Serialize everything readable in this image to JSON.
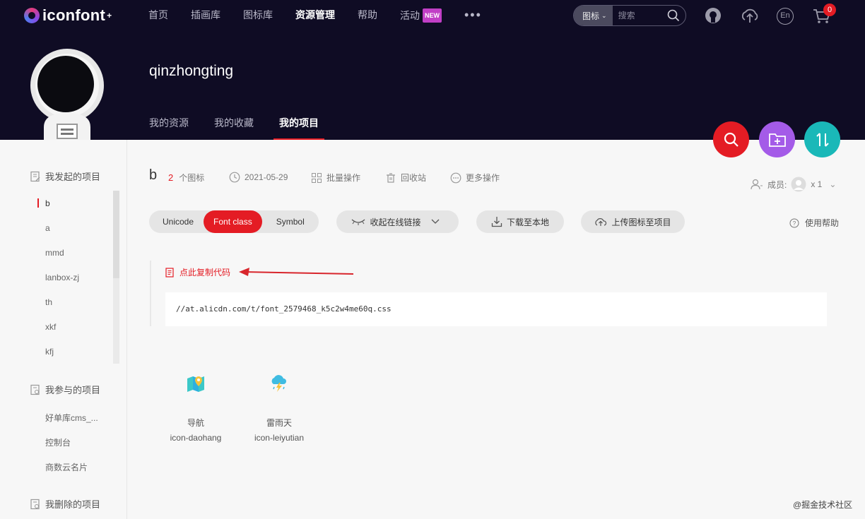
{
  "header": {
    "logo_text": "iconfont",
    "logo_sup": "+",
    "nav": [
      {
        "label": "首页",
        "active": false
      },
      {
        "label": "插画库",
        "active": false
      },
      {
        "label": "图标库",
        "active": false
      },
      {
        "label": "资源管理",
        "active": true
      },
      {
        "label": "帮助",
        "active": false
      },
      {
        "label": "活动",
        "active": false,
        "badge": "NEW"
      }
    ],
    "more": "•••",
    "search": {
      "type": "图标",
      "placeholder": "搜索"
    },
    "cart_count": "0",
    "lang": "En"
  },
  "profile": {
    "username": "qinzhongting",
    "tabs": [
      {
        "label": "我的资源",
        "active": false
      },
      {
        "label": "我的收藏",
        "active": false
      },
      {
        "label": "我的项目",
        "active": true
      }
    ]
  },
  "sidebar": {
    "initiated_title": "我发起的项目",
    "initiated": [
      "b",
      "a",
      "mmd",
      "lanbox-zj",
      "th",
      "xkf",
      "kfj"
    ],
    "joined_title": "我参与的项目",
    "joined": [
      "好单库cms_...",
      "控制台",
      "商数云名片"
    ],
    "deleted_title": "我删除的项目"
  },
  "project": {
    "name": "b",
    "icon_count": "2",
    "icon_count_unit": "个图标",
    "date": "2021-05-29",
    "batch": "批量操作",
    "recycle": "回收站",
    "more_ops": "更多操作",
    "members_label": "成员:",
    "members_count": "x 1"
  },
  "toolbar": {
    "segments": [
      {
        "label": "Unicode",
        "active": false
      },
      {
        "label": "Font class",
        "active": true
      },
      {
        "label": "Symbol",
        "active": false
      }
    ],
    "collapse_link": "收起在线链接",
    "download": "下载至本地",
    "upload": "上传图标至项目",
    "help": "使用帮助"
  },
  "code": {
    "copy_label": "点此复制代码",
    "url": "//at.alicdn.com/t/font_2579468_k5c2w4me60q.css"
  },
  "icons": [
    {
      "name": "导航",
      "class": "icon-daohang",
      "glyph": "map-icon"
    },
    {
      "name": "雷雨天",
      "class": "icon-leiyutian",
      "glyph": "thunderstorm-icon"
    }
  ],
  "watermark": "@掘金技术社区",
  "colors": {
    "accent": "#e41c24",
    "header_bg": "#0f0c24",
    "fab_search": "#e41c24",
    "fab_folder": "#a45be8",
    "fab_sort": "#1ab8b8"
  }
}
